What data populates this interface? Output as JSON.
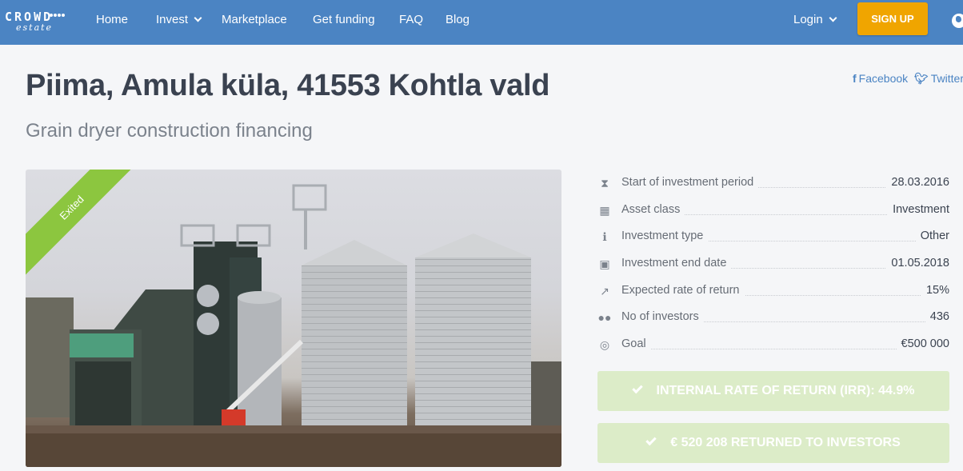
{
  "nav": {
    "logo_word": "CROWD",
    "logo_sub": "estate",
    "items": [
      {
        "label": "Home"
      },
      {
        "label": "Invest"
      },
      {
        "label": "Marketplace"
      },
      {
        "label": "Get funding"
      },
      {
        "label": "FAQ"
      },
      {
        "label": "Blog"
      }
    ],
    "login_label": "Login",
    "signup_label": "SIGN UP",
    "globe_icon": "globe-icon",
    "brand_color": "#4b84c3",
    "signup_color": "#f0a500"
  },
  "share": {
    "facebook": "Facebook",
    "twitter": "Twitter"
  },
  "project": {
    "title": "Piima, Amula küla, 41553 Kohtla vald",
    "subtitle": "Grain dryer construction financing",
    "status_ribbon": "Exited",
    "ribbon_color": "#8cc63f"
  },
  "details": [
    {
      "icon": "hourglass-icon",
      "label": "Start of investment period",
      "value": "28.03.2016"
    },
    {
      "icon": "building-icon",
      "label": "Asset class",
      "value": "Investment"
    },
    {
      "icon": "info-icon",
      "label": "Investment type",
      "value": "Other"
    },
    {
      "icon": "calendar-icon",
      "label": "Investment end date",
      "value": "01.05.2018"
    },
    {
      "icon": "chart-line-icon",
      "label": "Expected rate of return",
      "value": "15%"
    },
    {
      "icon": "users-icon",
      "label": "No of investors",
      "value": "436"
    },
    {
      "icon": "target-icon",
      "label": "Goal",
      "value": "€500 000"
    }
  ],
  "stats": {
    "irr": "INTERNAL RATE OF RETURN (IRR): 44.9%",
    "returned": "€ 520 208 RETURNED TO INVESTORS",
    "box_color": "#dcecc8"
  }
}
